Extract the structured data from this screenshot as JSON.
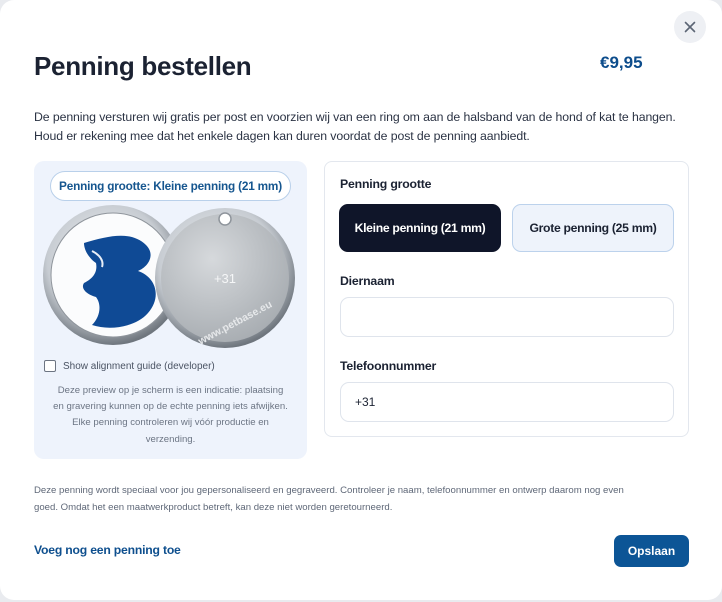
{
  "modal": {
    "title": "Penning bestellen",
    "price": "€9,95",
    "close_icon": "close-icon",
    "intro_line1": "De penning versturen wij gratis per post en voorzien wij van een ring om aan de halsband van de hond of kat te hangen.",
    "intro_line2": "Houd er rekening mee dat het enkele dagen kan duren voordat de post de penning aanbiedt."
  },
  "preview": {
    "size_pill": "Penning grootte: Kleine penning (21 mm)",
    "back_tag_text": "+31",
    "back_tag_url": "www.petbase.eu",
    "guide_label": "Show alignment guide (developer)",
    "guide_checked": false,
    "note_line1": "Deze preview op je scherm is een indicatie: plaatsing",
    "note_line2": "en gravering kunnen op de echte penning iets afwijken.",
    "note_line3": "Elke penning controleren wij vóór productie en",
    "note_line4": "verzending."
  },
  "form": {
    "size_label": "Penning grootte",
    "options": [
      {
        "label": "Kleine penning (21 mm)",
        "selected": true
      },
      {
        "label": "Grote penning (25 mm)",
        "selected": false
      }
    ],
    "pet_name_label": "Diernaam",
    "pet_name_value": "",
    "phone_label": "Telefoonnummer",
    "phone_value": "+31"
  },
  "footer": {
    "disclaimer_line1": "Deze penning wordt speciaal voor jou gepersonaliseerd en gegraveerd. Controleer je naam, telefoonnummer en ontwerp daarom nog even",
    "disclaimer_line2": "goed. Omdat het een maatwerkproduct betreft, kan deze niet worden geretourneerd.",
    "add_link": "Voeg nog een penning toe",
    "save_label": "Opslaan"
  },
  "colors": {
    "brand_blue": "#0c5596",
    "dark_button": "#0f1529",
    "logo_blue": "#0f4a95"
  }
}
